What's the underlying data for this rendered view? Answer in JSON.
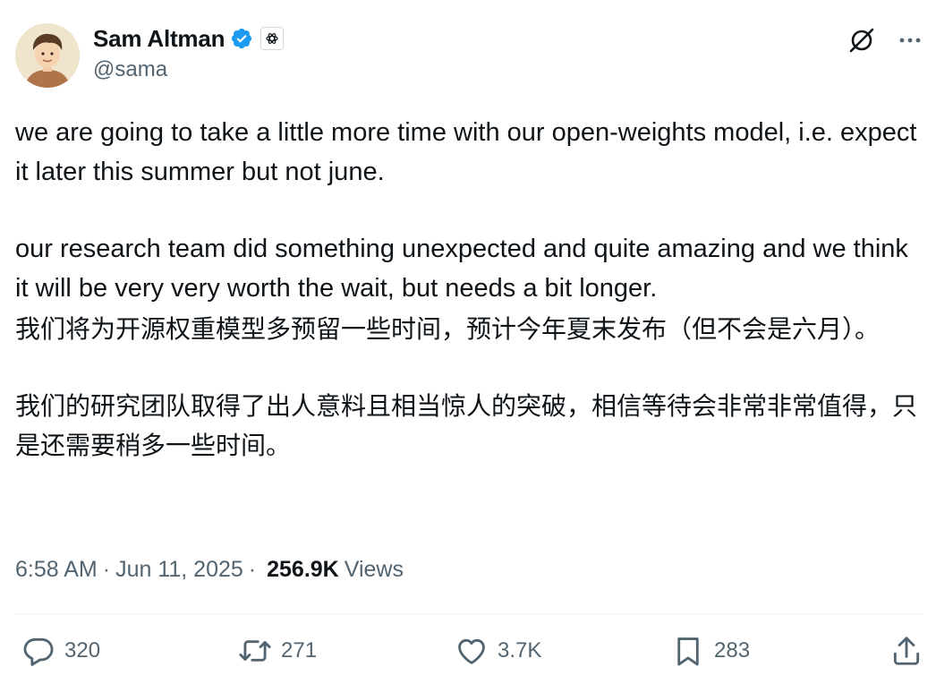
{
  "author": {
    "name": "Sam Altman",
    "handle": "@sama"
  },
  "tweet": {
    "paragraphs": [
      "we are going to take a little more time with our open-weights model, i.e. expect it later this summer but not june.",
      "our research team did something unexpected and quite amazing and we think it will be very very worth the wait, but needs a bit longer.",
      "我们将为开源权重模型多预留一些时间，预计今年夏末发布（但不会是六月）。",
      "我们的研究团队取得了出人意料且相当惊人的突破，相信等待会非常非常值得，只是还需要稍多一些时间。"
    ]
  },
  "meta": {
    "time": "6:58 AM",
    "date": "Jun 11, 2025",
    "views_count": "256.9K",
    "views_label": "Views"
  },
  "actions": {
    "replies": "320",
    "retweets": "271",
    "likes": "3.7K",
    "bookmarks": "283"
  },
  "colors": {
    "verified": "#1d9bf0",
    "secondary_text": "#536471",
    "primary_text": "#0f1419"
  },
  "icons": [
    "verified-badge-icon",
    "openai-org-icon",
    "grok-icon",
    "more-icon",
    "reply-icon",
    "retweet-icon",
    "like-icon",
    "bookmark-icon",
    "share-icon"
  ]
}
